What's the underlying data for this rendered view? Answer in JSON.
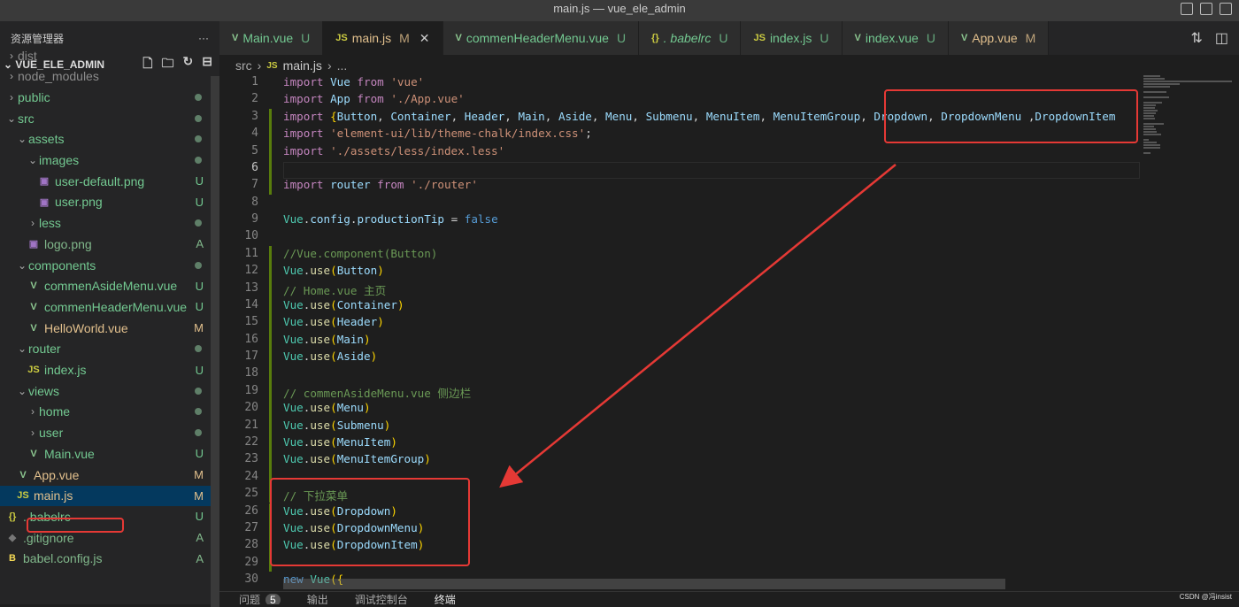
{
  "window": {
    "title": "main.js — vue_ele_admin"
  },
  "sidebar": {
    "header": "资源管理器",
    "more": "···",
    "root": "VUE_ELE_ADMIN",
    "items": [
      {
        "label": "dist",
        "depth": 0,
        "type": "folder",
        "open": false,
        "color": "#8c8c8c"
      },
      {
        "label": "node_modules",
        "depth": 0,
        "type": "folder",
        "open": false,
        "color": "#8c8c8c"
      },
      {
        "label": "public",
        "depth": 0,
        "type": "folder",
        "open": false,
        "color": "#73c991",
        "dot": true
      },
      {
        "label": "src",
        "depth": 0,
        "type": "folder",
        "open": true,
        "color": "#73c991",
        "dot": true
      },
      {
        "label": "assets",
        "depth": 1,
        "type": "folder",
        "open": true,
        "color": "#73c991",
        "dot": true
      },
      {
        "label": "images",
        "depth": 2,
        "type": "folder",
        "open": true,
        "color": "#73c991",
        "dot": true
      },
      {
        "label": "user-default.png",
        "depth": 3,
        "type": "image",
        "color": "#73c991",
        "badge": "U"
      },
      {
        "label": "user.png",
        "depth": 3,
        "type": "image",
        "color": "#73c991",
        "badge": "U"
      },
      {
        "label": "less",
        "depth": 2,
        "type": "folder",
        "open": false,
        "color": "#73c991",
        "dot": true
      },
      {
        "label": "logo.png",
        "depth": 2,
        "type": "image",
        "color": "#81b88b",
        "badge": "A"
      },
      {
        "label": "components",
        "depth": 1,
        "type": "folder",
        "open": true,
        "color": "#73c991",
        "dot": true
      },
      {
        "label": "commenAsideMenu.vue",
        "depth": 2,
        "type": "vue",
        "color": "#73c991",
        "badge": "U"
      },
      {
        "label": "commenHeaderMenu.vue",
        "depth": 2,
        "type": "vue",
        "color": "#73c991",
        "badge": "U"
      },
      {
        "label": "HelloWorld.vue",
        "depth": 2,
        "type": "vue",
        "color": "#e2c08d",
        "badge": "M"
      },
      {
        "label": "router",
        "depth": 1,
        "type": "folder",
        "open": true,
        "color": "#73c991",
        "dot": true
      },
      {
        "label": "index.js",
        "depth": 2,
        "type": "js",
        "color": "#73c991",
        "badge": "U"
      },
      {
        "label": "views",
        "depth": 1,
        "type": "folder",
        "open": true,
        "color": "#73c991",
        "dot": true
      },
      {
        "label": "home",
        "depth": 2,
        "type": "folder",
        "open": false,
        "color": "#73c991",
        "dot": true
      },
      {
        "label": "user",
        "depth": 2,
        "type": "folder",
        "open": false,
        "color": "#73c991",
        "dot": true
      },
      {
        "label": "Main.vue",
        "depth": 2,
        "type": "vue",
        "color": "#73c991",
        "badge": "U"
      },
      {
        "label": "App.vue",
        "depth": 1,
        "type": "vue",
        "color": "#e2c08d",
        "badge": "M"
      },
      {
        "label": "main.js",
        "depth": 1,
        "type": "js",
        "color": "#e2c08d",
        "badge": "M",
        "selected": true
      },
      {
        "label": ". babelrc",
        "depth": 0,
        "type": "json",
        "color": "#73c991",
        "badge": "U"
      },
      {
        "label": ".gitignore",
        "depth": 0,
        "type": "git",
        "color": "#81b88b",
        "badge": "A"
      },
      {
        "label": "babel.config.js",
        "depth": 0,
        "type": "babel",
        "color": "#81b88b",
        "badge": "A"
      }
    ]
  },
  "tabs": [
    {
      "label": "Main.vue",
      "status": "U",
      "type": "vue",
      "color": "#73c991"
    },
    {
      "label": "main.js",
      "status": "M",
      "type": "js",
      "color": "#e2c08d",
      "active": true,
      "close": "✕"
    },
    {
      "label": "commenHeaderMenu.vue",
      "status": "U",
      "type": "vue",
      "color": "#73c991"
    },
    {
      "label": ". babelrc",
      "status": "U",
      "type": "json",
      "color": "#73c991",
      "italic": true
    },
    {
      "label": "index.js",
      "status": "U",
      "type": "js",
      "color": "#73c991"
    },
    {
      "label": "index.vue",
      "status": "U",
      "type": "vue",
      "color": "#73c991"
    },
    {
      "label": "App.vue",
      "status": "M",
      "type": "vue",
      "color": "#e2c08d"
    }
  ],
  "breadcrumb": {
    "folder": "src",
    "file": "main.js",
    "rest": "..."
  },
  "code": [
    [
      [
        "kw",
        "import "
      ],
      [
        "var",
        "Vue "
      ],
      [
        "kw",
        "from "
      ],
      [
        "str",
        "'vue'"
      ]
    ],
    [
      [
        "kw",
        "import "
      ],
      [
        "var",
        "App "
      ],
      [
        "kw",
        "from "
      ],
      [
        "str",
        "'./App.vue'"
      ]
    ],
    [
      [
        "kw",
        "import "
      ],
      [
        "br",
        "{"
      ],
      [
        "var",
        "Button"
      ],
      [
        "pl",
        ", "
      ],
      [
        "var",
        "Container"
      ],
      [
        "pl",
        ", "
      ],
      [
        "var",
        "Header"
      ],
      [
        "pl",
        ", "
      ],
      [
        "var",
        "Main"
      ],
      [
        "pl",
        ", "
      ],
      [
        "var",
        "Aside"
      ],
      [
        "pl",
        ", "
      ],
      [
        "var",
        "Menu"
      ],
      [
        "pl",
        ", "
      ],
      [
        "var",
        "Submenu"
      ],
      [
        "pl",
        ", "
      ],
      [
        "var",
        "MenuItem"
      ],
      [
        "pl",
        ", "
      ],
      [
        "var",
        "MenuItemGroup"
      ],
      [
        "pl",
        ", "
      ],
      [
        "var",
        "Dropdown"
      ],
      [
        "pl",
        ", "
      ],
      [
        "var",
        "DropdownMenu"
      ],
      [
        "pl",
        " ,"
      ],
      [
        "var",
        "DropdownItem"
      ]
    ],
    [
      [
        "kw",
        "import "
      ],
      [
        "str",
        "'element-ui/lib/theme-chalk/index.css'"
      ],
      [
        "pl",
        ";"
      ]
    ],
    [
      [
        "kw",
        "import "
      ],
      [
        "str",
        "'./assets/less/index.less'"
      ]
    ],
    [],
    [
      [
        "kw",
        "import "
      ],
      [
        "var",
        "router "
      ],
      [
        "kw",
        "from "
      ],
      [
        "str",
        "'./router'"
      ]
    ],
    [],
    [
      [
        "cls",
        "Vue"
      ],
      [
        "pl",
        "."
      ],
      [
        "var",
        "config"
      ],
      [
        "pl",
        "."
      ],
      [
        "var",
        "productionTip"
      ],
      [
        "pl",
        " = "
      ],
      [
        "bool",
        "false"
      ]
    ],
    [],
    [
      [
        "cm",
        "//Vue.component(Button)"
      ]
    ],
    [
      [
        "cls",
        "Vue"
      ],
      [
        "pl",
        "."
      ],
      [
        "fn",
        "use"
      ],
      [
        "br",
        "("
      ],
      [
        "var",
        "Button"
      ],
      [
        "br",
        ")"
      ]
    ],
    [
      [
        "cm",
        "// Home.vue 主页"
      ]
    ],
    [
      [
        "cls",
        "Vue"
      ],
      [
        "pl",
        "."
      ],
      [
        "fn",
        "use"
      ],
      [
        "br",
        "("
      ],
      [
        "var",
        "Container"
      ],
      [
        "br",
        ")"
      ]
    ],
    [
      [
        "cls",
        "Vue"
      ],
      [
        "pl",
        "."
      ],
      [
        "fn",
        "use"
      ],
      [
        "br",
        "("
      ],
      [
        "var",
        "Header"
      ],
      [
        "br",
        ")"
      ]
    ],
    [
      [
        "cls",
        "Vue"
      ],
      [
        "pl",
        "."
      ],
      [
        "fn",
        "use"
      ],
      [
        "br",
        "("
      ],
      [
        "var",
        "Main"
      ],
      [
        "br",
        ")"
      ]
    ],
    [
      [
        "cls",
        "Vue"
      ],
      [
        "pl",
        "."
      ],
      [
        "fn",
        "use"
      ],
      [
        "br",
        "("
      ],
      [
        "var",
        "Aside"
      ],
      [
        "br",
        ")"
      ]
    ],
    [],
    [
      [
        "cm",
        "// commenAsideMenu.vue 侧边栏"
      ]
    ],
    [
      [
        "cls",
        "Vue"
      ],
      [
        "pl",
        "."
      ],
      [
        "fn",
        "use"
      ],
      [
        "br",
        "("
      ],
      [
        "var",
        "Menu"
      ],
      [
        "br",
        ")"
      ]
    ],
    [
      [
        "cls",
        "Vue"
      ],
      [
        "pl",
        "."
      ],
      [
        "fn",
        "use"
      ],
      [
        "br",
        "("
      ],
      [
        "var",
        "Submenu"
      ],
      [
        "br",
        ")"
      ]
    ],
    [
      [
        "cls",
        "Vue"
      ],
      [
        "pl",
        "."
      ],
      [
        "fn",
        "use"
      ],
      [
        "br",
        "("
      ],
      [
        "var",
        "MenuItem"
      ],
      [
        "br",
        ")"
      ]
    ],
    [
      [
        "cls",
        "Vue"
      ],
      [
        "pl",
        "."
      ],
      [
        "fn",
        "use"
      ],
      [
        "br",
        "("
      ],
      [
        "var",
        "MenuItemGroup"
      ],
      [
        "br",
        ")"
      ]
    ],
    [],
    [
      [
        "cm",
        "// 下拉菜单"
      ]
    ],
    [
      [
        "cls",
        "Vue"
      ],
      [
        "pl",
        "."
      ],
      [
        "fn",
        "use"
      ],
      [
        "br",
        "("
      ],
      [
        "var",
        "Dropdown"
      ],
      [
        "br",
        ")"
      ]
    ],
    [
      [
        "cls",
        "Vue"
      ],
      [
        "pl",
        "."
      ],
      [
        "fn",
        "use"
      ],
      [
        "br",
        "("
      ],
      [
        "var",
        "DropdownMenu"
      ],
      [
        "br",
        ")"
      ]
    ],
    [
      [
        "cls",
        "Vue"
      ],
      [
        "pl",
        "."
      ],
      [
        "fn",
        "use"
      ],
      [
        "br",
        "("
      ],
      [
        "var",
        "DropdownItem"
      ],
      [
        "br",
        ")"
      ]
    ],
    [],
    [
      [
        "bool",
        "new "
      ],
      [
        "cls",
        "Vue"
      ],
      [
        "br",
        "({"
      ]
    ]
  ],
  "panel": {
    "tabs": [
      "问题",
      "输出",
      "调试控制台",
      "终端"
    ],
    "problems_count": "5"
  },
  "watermark": "CSDN @冯insist",
  "annotation_color": "#e53935"
}
